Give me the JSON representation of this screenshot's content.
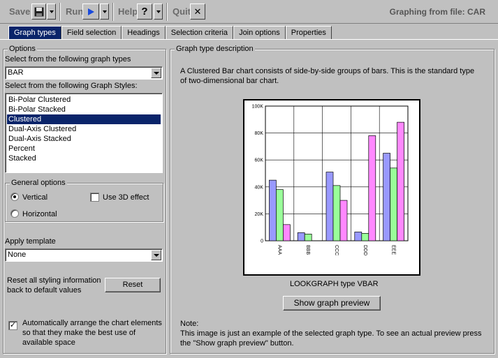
{
  "toolbar": {
    "save_label": "Save",
    "run_label": "Run",
    "help_label": "Help",
    "help_glyph": "?",
    "quit_label": "Quit",
    "quit_glyph": "✕",
    "title": "Graphing from file: CAR"
  },
  "tabs": [
    {
      "label": "Graph types",
      "active": true
    },
    {
      "label": "Field selection"
    },
    {
      "label": "Headings"
    },
    {
      "label": "Selection criteria"
    },
    {
      "label": "Join options"
    },
    {
      "label": "Properties"
    }
  ],
  "options": {
    "legend": "Options",
    "graph_types_label": "Select from the following graph types",
    "graph_type_value": "BAR",
    "graph_styles_label": "Select from the following Graph Styles:",
    "graph_styles": [
      "Bi-Polar Clustered",
      "Bi-Polar Stacked",
      "Clustered",
      "Dual-Axis Clustered",
      "Dual-Axis Stacked",
      "Percent",
      "Stacked"
    ],
    "selected_style": "Clustered",
    "general_legend": "General options",
    "vertical_label": "Vertical",
    "horizontal_label": "Horizontal",
    "use3d_label": "Use 3D effect",
    "template_label": "Apply template",
    "template_value": "None",
    "reset_text_1": "Reset all styling information",
    "reset_text_2": "back to default values",
    "reset_button": "Reset",
    "auto_text_1": "Automatically arrange the chart elements",
    "auto_text_2": "so that they make the best use of",
    "auto_text_3": "available space"
  },
  "description": {
    "legend": "Graph type description",
    "line1": "A Clustered Bar chart consists of side-by-side groups of bars. This is the standard type",
    "line2": "of two-dimensional bar chart.",
    "caption": "LOOKGRAPH type VBAR",
    "preview_button": "Show graph preview",
    "note_title": "Note:",
    "note_line1": "This image is just an example of the selected graph type. To see an actual preview press",
    "note_line2": "the \"Show graph preview\" button."
  },
  "chart_data": {
    "type": "bar",
    "categories": [
      "AAA",
      "BBB",
      "CCC",
      "DDD",
      "EEE"
    ],
    "series": [
      {
        "values": [
          45000,
          6000,
          51000,
          6500,
          65000
        ],
        "color": "#9999ff"
      },
      {
        "values": [
          38000,
          5000,
          41000,
          5500,
          54000
        ],
        "color": "#99ff99"
      },
      {
        "values": [
          12000,
          0,
          30000,
          78000,
          88000
        ],
        "color": "#ff88ff"
      }
    ],
    "ylim": [
      0,
      100000
    ],
    "yticks": [
      "0",
      "20K",
      "40K",
      "60K",
      "80K",
      "100K"
    ],
    "grid": true
  }
}
